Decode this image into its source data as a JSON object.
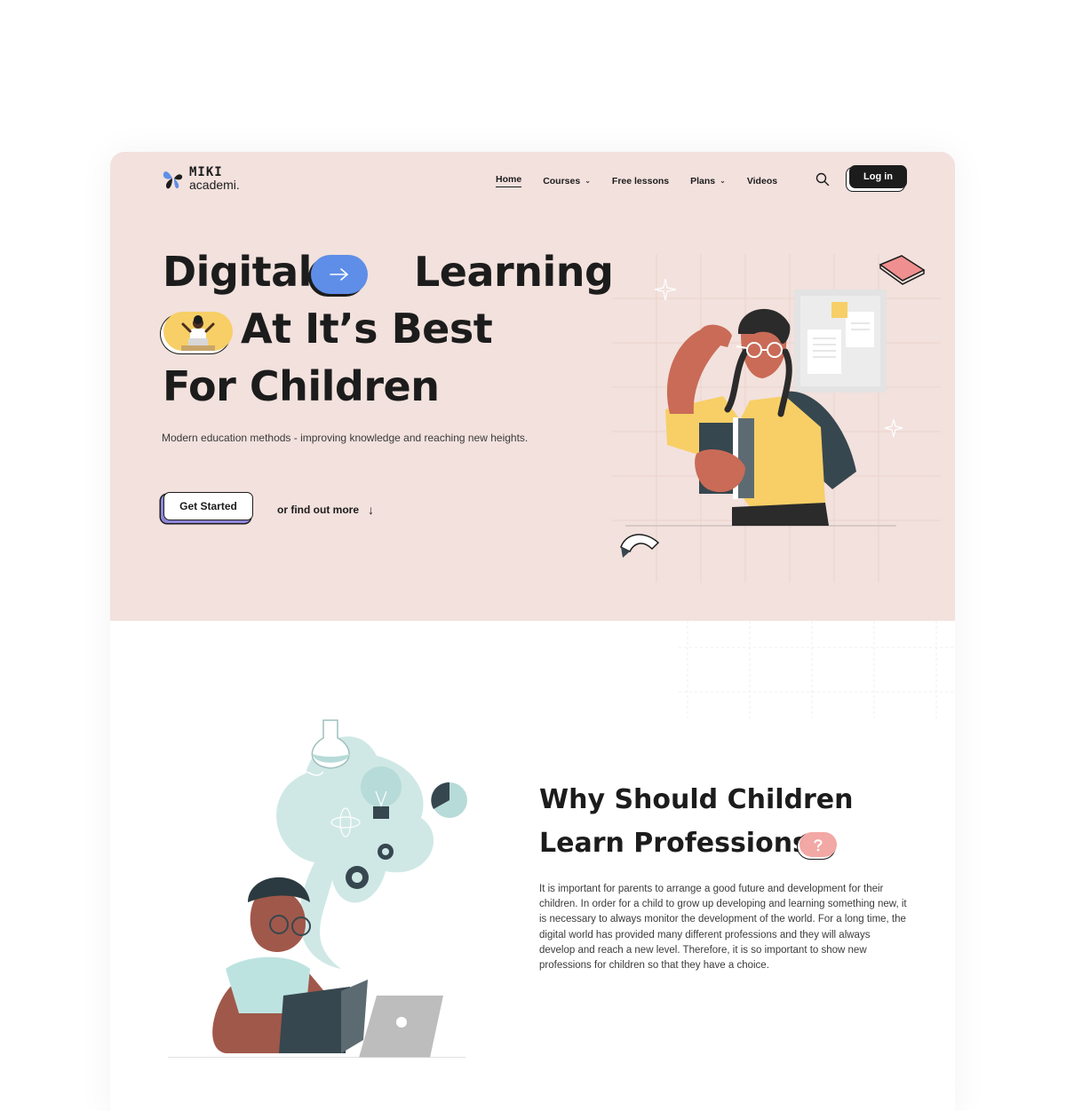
{
  "brand": {
    "name_top": "MIKI",
    "name_bottom": "academi."
  },
  "nav": {
    "items": [
      {
        "label": "Home",
        "active": true,
        "dropdown": false
      },
      {
        "label": "Courses",
        "active": false,
        "dropdown": true
      },
      {
        "label": "Free lessons",
        "active": false,
        "dropdown": false
      },
      {
        "label": "Plans",
        "active": false,
        "dropdown": true
      },
      {
        "label": "Videos",
        "active": false,
        "dropdown": false
      }
    ],
    "search_icon": "search-icon",
    "login_label": "Log in"
  },
  "hero": {
    "line1_a": "Digital",
    "line1_b": "Learning",
    "line2": "At It’s Best",
    "line3": "For Children",
    "subtitle": "Modern education methods - improving knowledge and reaching new heights.",
    "cta_label": "Get Started",
    "secondary_label": "or find out more"
  },
  "why": {
    "title_line1": "Why Should Children",
    "title_line2": "Learn Professions",
    "body": "It is important for parents to arrange a good future and development for their children. In order for a child to grow up developing and learning something new, it is necessary to always monitor the development of the world. For a long time, the digital world has provided many different professions and they will always develop and reach a new level. Therefore, it is so important to show new professions for children so that they have a choice."
  },
  "colors": {
    "hero_bg": "#f2e1dd",
    "accent_blue": "#5f8ee8",
    "accent_yellow": "#f7cf66",
    "accent_purple": "#8d86d8",
    "accent_pink": "#f2a8a4",
    "text_dark": "#1c1c1c"
  }
}
